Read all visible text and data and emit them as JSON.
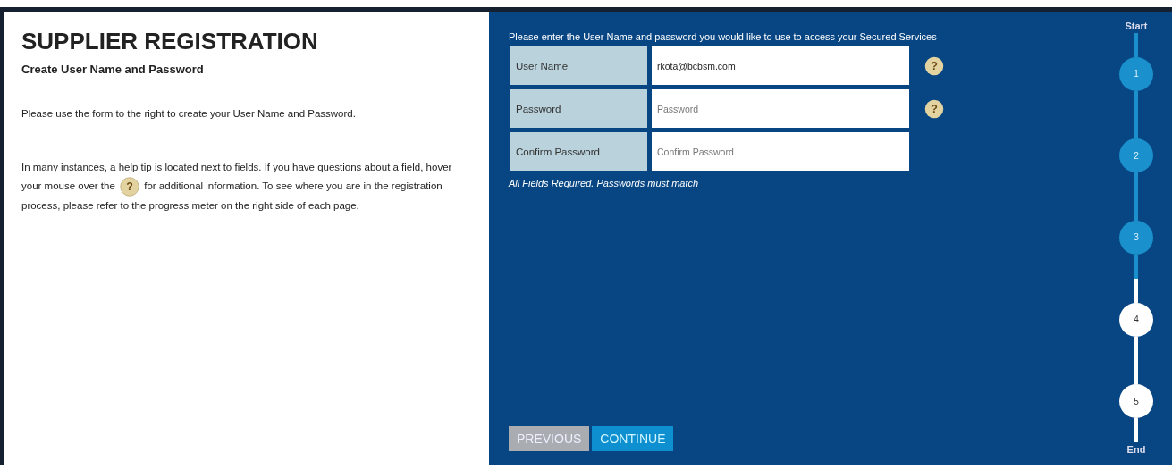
{
  "title": "SUPPLIER REGISTRATION",
  "subtitle": "Create User Name and Password",
  "intro": "Please use the form to the right to create your User Name and Password.",
  "help_text": {
    "before": "In many instances, a help tip is located next to fields. If you have questions about a field, hover your mouse over the",
    "after": "for additional information. To see where you are in the registration process, please refer to the progress meter on the right side of each page."
  },
  "help_glyph": "?",
  "form": {
    "instruction": "Please enter the User Name and password you would like to use to access your Secured Services",
    "fields": [
      {
        "label": "User Name",
        "value": "rkota@bcbsm.com",
        "help": true
      },
      {
        "label": "Password",
        "placeholder": "Password",
        "help": true
      },
      {
        "label": "Confirm Password",
        "placeholder": "Confirm Password",
        "help": false
      }
    ],
    "note": "All Fields Required. Passwords must match"
  },
  "buttons": [
    {
      "label": "PREVIOUS",
      "kind": "secondary"
    },
    {
      "label": "CONTINUE",
      "kind": "primary"
    }
  ],
  "progress": {
    "start": "Start",
    "end": "End",
    "steps": [
      {
        "label": "1",
        "done": true
      },
      {
        "label": "2",
        "done": true
      },
      {
        "label": "3",
        "done": true
      },
      {
        "label": "4",
        "done": false
      },
      {
        "label": "5",
        "done": false
      }
    ]
  }
}
